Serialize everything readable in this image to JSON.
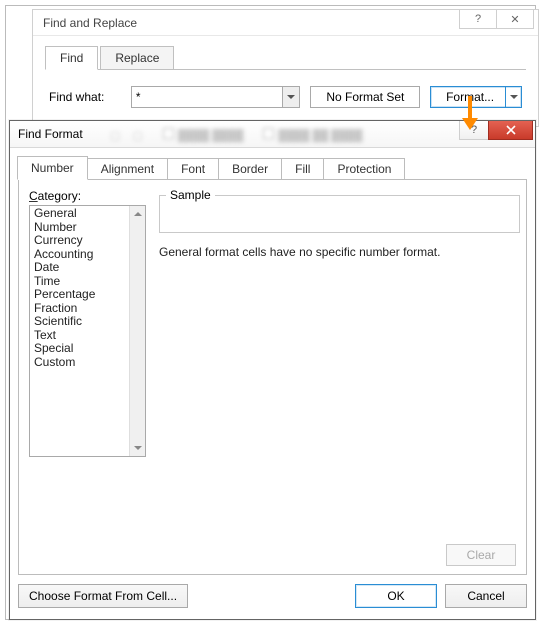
{
  "find_replace": {
    "title": "Find and Replace",
    "help_glyph": "?",
    "close_glyph": "✕",
    "tabs": {
      "find": "Find",
      "replace": "Replace"
    },
    "find_what_label": "Find what:",
    "find_what_value": "*",
    "no_format_label": "No Format Set",
    "format_button": "Format..."
  },
  "find_format": {
    "title": "Find Format",
    "help_glyph": "?",
    "tabs": {
      "number": "Number",
      "alignment": "Alignment",
      "font": "Font",
      "border": "Border",
      "fill": "Fill",
      "protection": "Protection"
    },
    "category_label": "Category:",
    "category_underline": "C",
    "categories": [
      "General",
      "Number",
      "Currency",
      "Accounting",
      "Date",
      "Time",
      "Percentage",
      "Fraction",
      "Scientific",
      "Text",
      "Special",
      "Custom"
    ],
    "sample_label": "Sample",
    "description": "General format cells have no specific number format.",
    "clear_label": "Clear",
    "choose_from_cell": "Choose Format From Cell...",
    "ok_label": "OK",
    "cancel_label": "Cancel"
  }
}
